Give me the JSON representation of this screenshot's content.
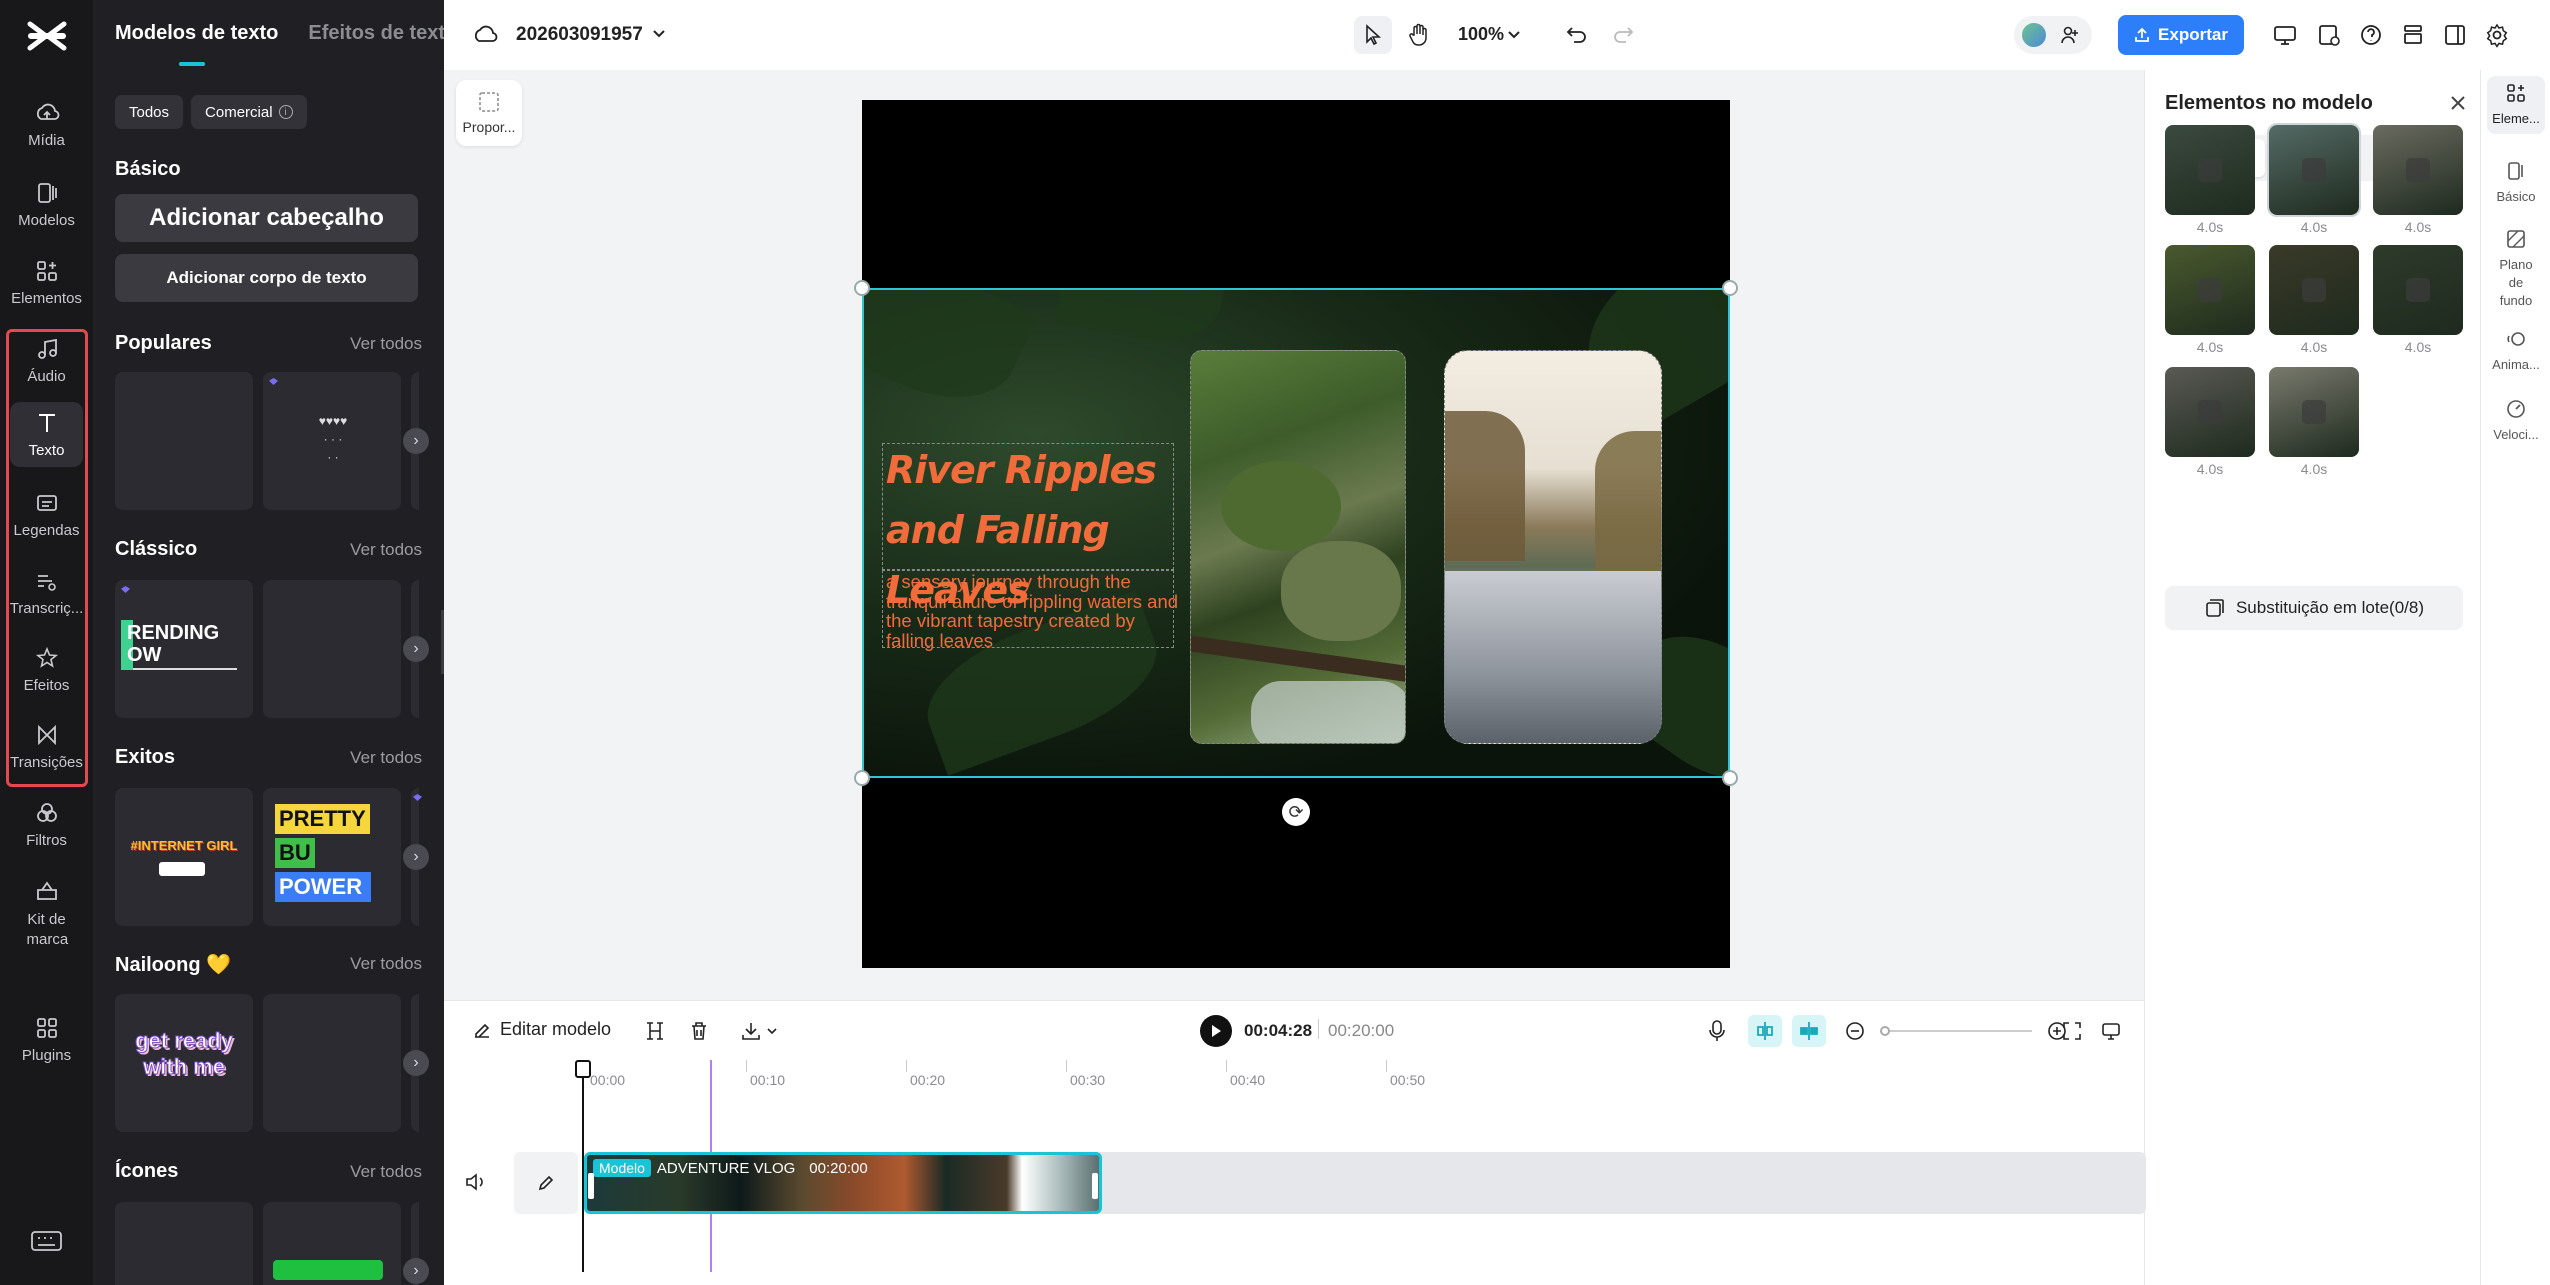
{
  "rail": {
    "items": [
      {
        "label": "Mídia",
        "icon": "cloud-upload-icon"
      },
      {
        "label": "Modelos",
        "icon": "template-icon"
      },
      {
        "label": "Elementos",
        "icon": "elements-icon"
      },
      {
        "label": "Áudio",
        "icon": "music-note-icon"
      },
      {
        "label": "Texto",
        "icon": "text-icon"
      },
      {
        "label": "Legendas",
        "icon": "captions-icon"
      },
      {
        "label": "Transcriç...",
        "icon": "transcription-icon"
      },
      {
        "label": "Efeitos",
        "icon": "effects-star-icon"
      },
      {
        "label": "Transições",
        "icon": "transitions-icon"
      },
      {
        "label": "Filtros",
        "icon": "filters-icon"
      },
      {
        "label": "Kit de marca",
        "icon": "brand-kit-icon"
      },
      {
        "label": "Plugins",
        "icon": "plugins-icon"
      }
    ],
    "active": "Texto"
  },
  "panel": {
    "tabs": [
      "Modelos de texto",
      "Efeitos de texto"
    ],
    "chips": [
      "Todos",
      "Comercial"
    ],
    "basic_title": "Básico",
    "add_heading": "Adicionar cabeçalho",
    "add_body": "Adicionar corpo de texto",
    "see_all": "Ver todos",
    "sections": [
      "Populares",
      "Clássico",
      "Exitos",
      "Nailoong 💛",
      "Ícones"
    ],
    "card_texts": {
      "trending": "RENDING\nOW",
      "pretty": [
        "PRETTY",
        "BU",
        "POWER"
      ],
      "ready": "get ready\nwith me",
      "internet": "#INTERNET GIRL"
    }
  },
  "topbar": {
    "project": "202603091957",
    "zoom": "100%",
    "export": "Exportar"
  },
  "canvas": {
    "ratio_label": "Propor...",
    "title": "River Ripples and Falling Leaves",
    "subtitle": "a sensory journey through the tranquil allure of rippling waters and the vibrant tapestry created by falling leaves"
  },
  "right_panel": {
    "title": "Elementos no modelo",
    "durations": [
      "4.0s",
      "4.0s",
      "4.0s",
      "4.0s",
      "4.0s",
      "4.0s",
      "4.0s",
      "4.0s"
    ],
    "thumb_colors": [
      "#3b4a3f",
      "#556b66",
      "#6b6b60",
      "#4a5a2e",
      "#3a3a28",
      "#2e3a2a",
      "#5a5a54",
      "#7a7a6e"
    ],
    "batch": "Substituição em lote(0/8)"
  },
  "right_rail": {
    "items": [
      "Eleme...",
      "Básico",
      "Plano de fundo",
      "Anima...",
      "Veloci..."
    ]
  },
  "timeline": {
    "edit_model": "Editar modelo",
    "current": "00:04:28",
    "total": "00:20:00",
    "ruler": [
      "00:00",
      "00:10",
      "00:20",
      "00:30",
      "00:40",
      "00:50"
    ],
    "clip_badge": "Modelo",
    "clip_name": "ADVENTURE VLOG",
    "clip_duration": "00:20:00"
  },
  "colors": {
    "accent": "#19c4d7",
    "export": "#2d7ff9",
    "title_orange": "#f26b3a",
    "highlight_red": "#e5484d"
  }
}
